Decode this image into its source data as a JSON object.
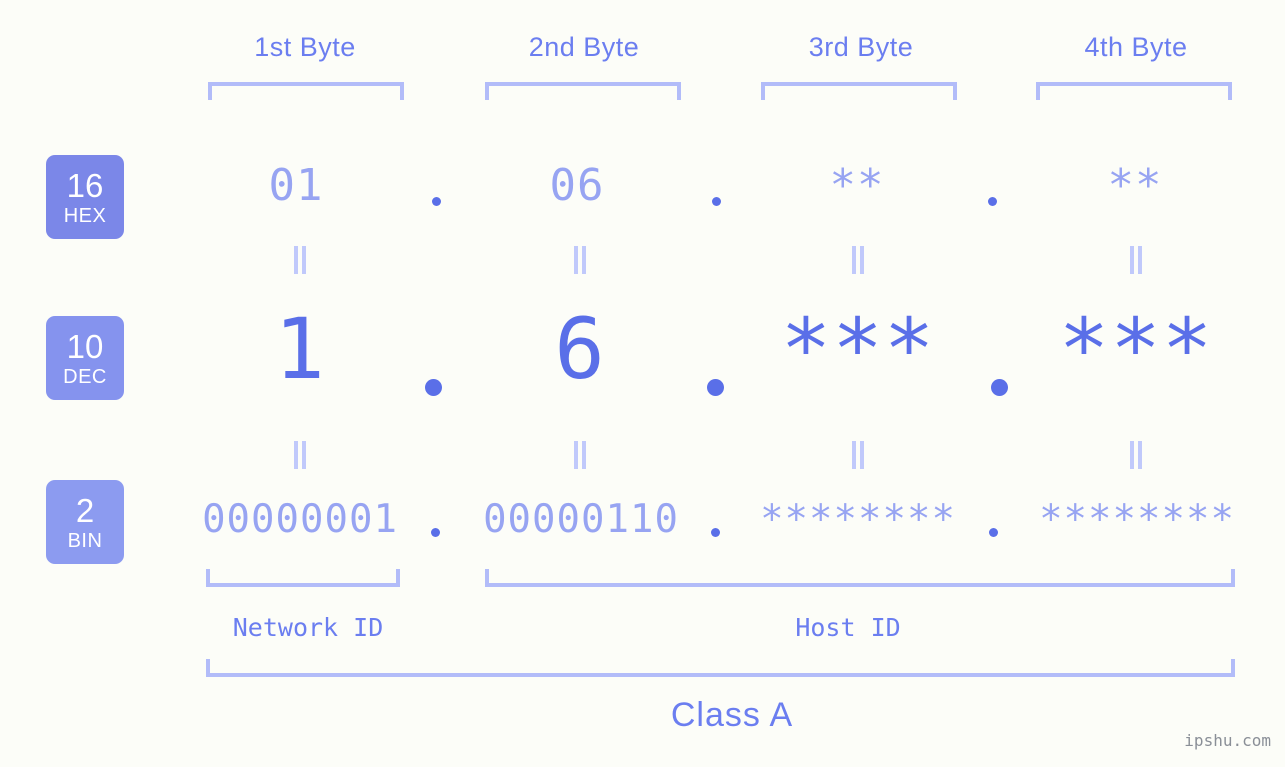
{
  "headers": [
    {
      "label": "1st Byte"
    },
    {
      "label": "2nd Byte"
    },
    {
      "label": "3rd Byte"
    },
    {
      "label": "4th Byte"
    }
  ],
  "bases": [
    {
      "number": "16",
      "name": "HEX",
      "color": "#7b87e8"
    },
    {
      "number": "10",
      "name": "DEC",
      "color": "#8593ee"
    },
    {
      "number": "2",
      "name": "BIN",
      "color": "#8c9bf0"
    }
  ],
  "rows": {
    "hex": {
      "values": [
        "01",
        "06",
        "**",
        "**"
      ]
    },
    "dec": {
      "values": [
        "1",
        "6",
        "***",
        "***"
      ]
    },
    "bin": {
      "values": [
        "00000001",
        "00000110",
        "********",
        "********"
      ]
    }
  },
  "separator": ".",
  "equality_symbol": "||",
  "segments": {
    "network_id": "Network ID",
    "host_id": "Host ID"
  },
  "class_label": "Class A",
  "watermark": "ipshu.com",
  "colors": {
    "background": "#fcfdf8",
    "accent_strong": "#5a6fe8",
    "accent_mid": "#6b7ef0",
    "accent_light": "#97a4f2",
    "bracket": "#b2bcf9",
    "equality": "#c0c9fb",
    "watermark": "#8a8f97"
  }
}
